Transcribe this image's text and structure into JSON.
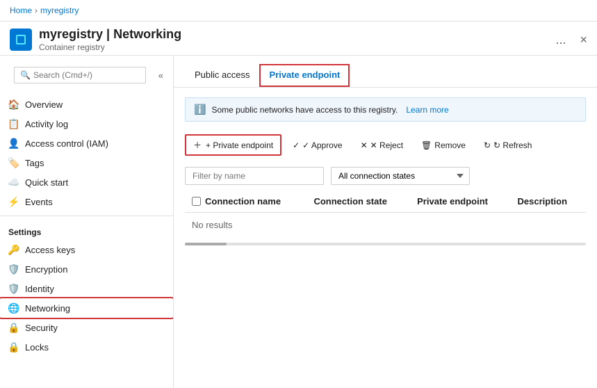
{
  "breadcrumb": {
    "home": "Home",
    "registry": "myregistry"
  },
  "header": {
    "title": "myregistry | Networking",
    "subtitle": "Container registry",
    "dots_label": "...",
    "close_label": "×"
  },
  "sidebar": {
    "search_placeholder": "Search (Cmd+/)",
    "collapse_label": "«",
    "nav_items": [
      {
        "id": "overview",
        "label": "Overview",
        "icon": "🏠"
      },
      {
        "id": "activity-log",
        "label": "Activity log",
        "icon": "📋"
      },
      {
        "id": "access-control",
        "label": "Access control (IAM)",
        "icon": "👤"
      },
      {
        "id": "tags",
        "label": "Tags",
        "icon": "🏷️"
      },
      {
        "id": "quick-start",
        "label": "Quick start",
        "icon": "☁️"
      },
      {
        "id": "events",
        "label": "Events",
        "icon": "⚡"
      }
    ],
    "settings_label": "Settings",
    "settings_items": [
      {
        "id": "access-keys",
        "label": "Access keys",
        "icon": "🔑"
      },
      {
        "id": "encryption",
        "label": "Encryption",
        "icon": "🛡️"
      },
      {
        "id": "identity",
        "label": "Identity",
        "icon": "🛡️"
      },
      {
        "id": "networking",
        "label": "Networking",
        "icon": "🌐",
        "active": true
      },
      {
        "id": "security",
        "label": "Security",
        "icon": "🔒"
      },
      {
        "id": "locks",
        "label": "Locks",
        "icon": "🔒"
      }
    ]
  },
  "content": {
    "tabs": [
      {
        "id": "public-access",
        "label": "Public access",
        "active": false
      },
      {
        "id": "private-endpoint",
        "label": "Private endpoint",
        "active": true
      }
    ],
    "info_banner": {
      "text": "Some public networks have access to this registry.",
      "link_text": "Learn more"
    },
    "toolbar": {
      "add_endpoint_label": "+ Private endpoint",
      "approve_label": "✓ Approve",
      "reject_label": "✕ Reject",
      "remove_label": "🗑 Remove",
      "refresh_label": "↻ Refresh"
    },
    "filter": {
      "name_placeholder": "Filter by name",
      "state_default": "All connection states"
    },
    "table": {
      "headers": [
        "Connection name",
        "Connection state",
        "Private endpoint",
        "Description"
      ],
      "no_results": "No results"
    }
  }
}
